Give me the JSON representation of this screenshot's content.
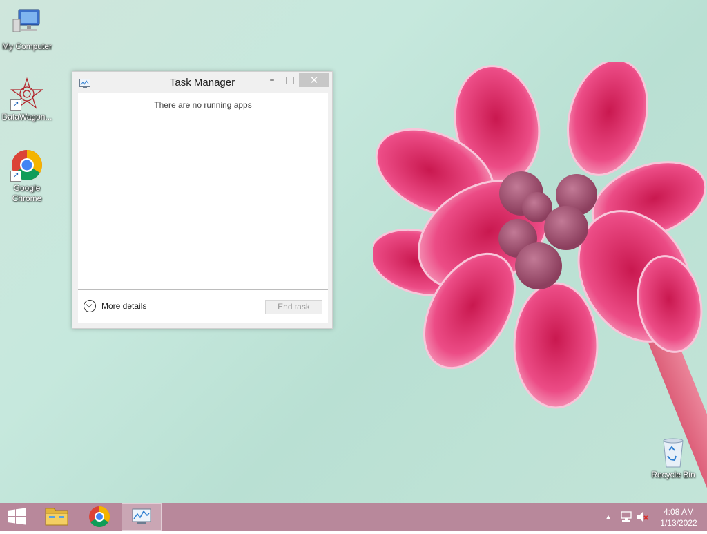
{
  "desktop": {
    "icons": [
      {
        "label": "My Computer"
      },
      {
        "label": "DataWagon..."
      },
      {
        "label": "Google Chrome"
      },
      {
        "label": "Recycle Bin"
      }
    ]
  },
  "task_manager": {
    "title": "Task Manager",
    "empty_message": "There are no running apps",
    "more_details_label": "More details",
    "end_task_label": "End task",
    "close_glyph": "✕",
    "minimize_glyph": "–",
    "maximize_glyph": "□"
  },
  "taskbar": {
    "items": [
      {
        "icon": "windows-logo-icon"
      },
      {
        "icon": "file-explorer-icon"
      },
      {
        "icon": "chrome-icon"
      },
      {
        "icon": "task-manager-icon"
      }
    ],
    "tray": {
      "overflow_glyph": "▲",
      "time": "4:08 AM",
      "date": "1/13/2022"
    }
  },
  "colors": {
    "taskbar": "#b8889b",
    "desktop": "#c6e8dd",
    "flower": "#e8407a"
  }
}
